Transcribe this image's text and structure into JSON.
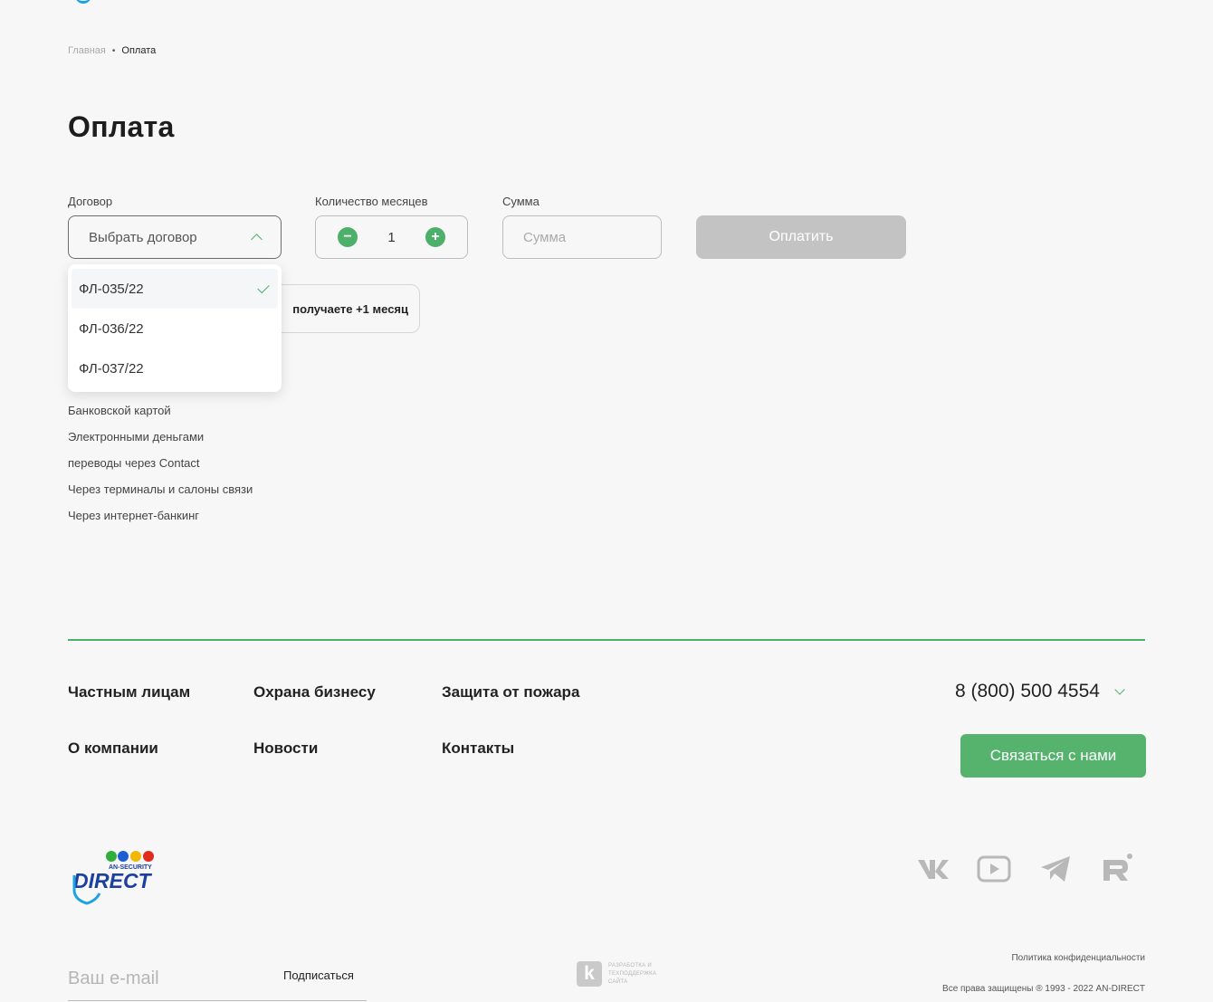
{
  "breadcrumb": {
    "home": "Главная",
    "separator": "•",
    "current": "Оплата"
  },
  "page_title": "Оплата",
  "form": {
    "contract_label": "Договор",
    "contract_placeholder": "Выбрать договор",
    "months_label": "Количество месяцев",
    "months_value": "1",
    "minus_symbol": "−",
    "plus_symbol": "+",
    "sum_label": "Сумма",
    "sum_placeholder": "Сумма",
    "pay_button": "Оплатить",
    "promo_text": "получаете +1 месяц"
  },
  "dropdown": {
    "items": [
      {
        "label": "ФЛ-035/22",
        "selected": true
      },
      {
        "label": "ФЛ-036/22",
        "selected": false
      },
      {
        "label": "ФЛ-037/22",
        "selected": false
      }
    ]
  },
  "payment_methods": [
    "Банковской картой",
    "Электронными деньгами",
    "переводы через Contact",
    "Через терминалы и салоны связи",
    "Через интернет-банкинг"
  ],
  "footer": {
    "nav": {
      "private": "Частным лицам",
      "business": "Охрана бизнесу",
      "fire": "Защита от пожара",
      "about": "О компании",
      "news": "Новости",
      "contacts": "Контакты"
    },
    "phone": "8 (800) 500 4554",
    "contact_button": "Связаться с нами",
    "logo": {
      "top_text": "AN-SECURITY",
      "main_text": "DIRECT"
    },
    "social_icons": [
      "vk-icon",
      "youtube-icon",
      "telegram-icon",
      "rutube-icon"
    ],
    "email_placeholder": "Ваш e-mail",
    "subscribe": "Подписаться",
    "developer": {
      "letter": "k",
      "line1": "РАЗРАБОТКА И",
      "line2": "ТЕХПОДДЕРЖКА",
      "line3": "САЙТА"
    },
    "privacy": "Политика конфиденциальности",
    "rights": "Все права защищены  ® 1993 - 2022 AN-DIRECT"
  },
  "colors": {
    "accent_green": "#4caf6a",
    "button_green": "#55b36e",
    "disabled_button": "#c3c3c3",
    "background": "#f7f7f7"
  }
}
